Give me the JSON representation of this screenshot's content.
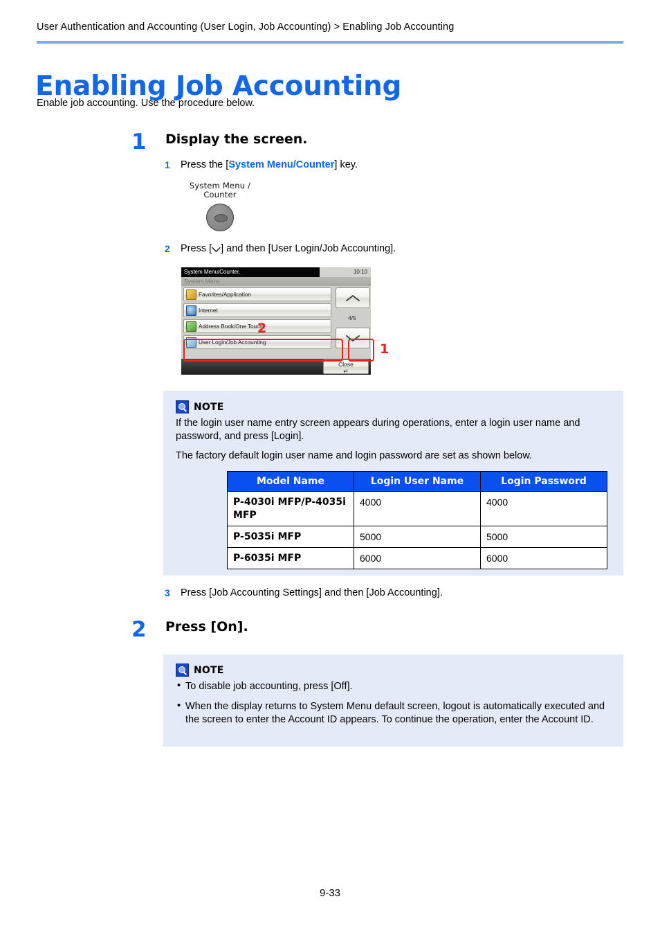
{
  "header": {
    "breadcrumb": "User Authentication and Accounting (User Login, Job Accounting) > Enabling Job Accounting",
    "title": "Enabling Job Accounting",
    "intro": "Enable job accounting. Use the procedure below."
  },
  "steps": [
    {
      "number": "1",
      "title": "Display the screen.",
      "substeps": [
        {
          "number": "1",
          "text_before": "Press the [",
          "keyword": "System Menu/Counter",
          "text_after": "] key."
        },
        {
          "number": "2",
          "text_before": "Press [",
          "icon": "chevron-down-icon",
          "text_after": "] and then [User Login/Job Accounting]."
        },
        {
          "number": "3",
          "text": "Press [Job Accounting Settings] and then [Job Accounting]."
        }
      ]
    },
    {
      "number": "2",
      "title": "Press [On]."
    }
  ],
  "hardware_key": {
    "label_line1": "System Menu /",
    "label_line2": "Counter"
  },
  "panel": {
    "status_message": "System Menu/Counter.",
    "clock": "10:10",
    "screen_title": "System Menu",
    "items": [
      {
        "label": "Favorites/Application",
        "icon": "favorites-icon"
      },
      {
        "label": "Internet",
        "icon": "internet-icon"
      },
      {
        "label": "Address Book/One Touch",
        "icon": "address-book-icon"
      },
      {
        "label": "User Login/Job Accounting",
        "icon": "user-login-icon"
      }
    ],
    "page_indicator": "4/5",
    "close_label": "Close",
    "return_glyph": "↵",
    "up_arrow": "chevron-up-icon",
    "down_arrow": "chevron-down-icon",
    "callouts": [
      {
        "number": "2",
        "target": "user-login-job-accounting-item"
      },
      {
        "number": "1",
        "target": "scroll-down-button"
      }
    ],
    "highlight_color": "#e8231f"
  },
  "note1": {
    "title": "NOTE",
    "paragraph1": "If the login user name entry screen appears during operations, enter a login user name and password, and press [Login].",
    "paragraph2": "The factory default login user name and login password are set as shown below.",
    "table": {
      "headers": [
        "Model Name",
        "Login User Name",
        "Login Password"
      ],
      "rows": [
        [
          "P-4030i MFP/P-4035i MFP",
          "4000",
          "4000"
        ],
        [
          "P-5035i MFP",
          "5000",
          "5000"
        ],
        [
          "P-6035i MFP",
          "6000",
          "6000"
        ]
      ]
    }
  },
  "note2": {
    "title": "NOTE",
    "bullets": [
      "To disable job accounting, press [Off].",
      "When the display returns to System Menu default screen, logout is automatically executed and the screen to enter the Account ID appears. To continue the operation, enter the Account ID."
    ]
  },
  "footer": {
    "page_number": "9-33"
  },
  "colors": {
    "accent_blue": "#1267e8",
    "rule_blue": "#7da7ef",
    "note_bg": "#e4eaf8",
    "table_header": "#0a50ee",
    "callout_red": "#e8231f"
  }
}
